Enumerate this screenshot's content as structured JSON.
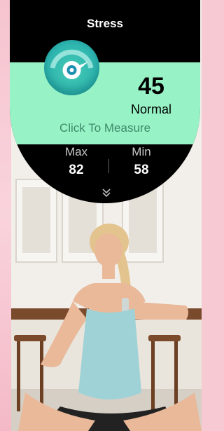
{
  "watch": {
    "title": "Stress",
    "stress_value": "45",
    "stress_status": "Normal",
    "measure_label": "Click To Measure",
    "max_label": "Max",
    "max_value": "82",
    "min_label": "Min",
    "min_value": "58"
  },
  "icons": {
    "gauge": "stress-gauge-icon",
    "more": "chevron-down-icon"
  },
  "colors": {
    "band": "#97f3c6",
    "gauge": "#2fb7b0",
    "frame": "#f7c9d3"
  }
}
